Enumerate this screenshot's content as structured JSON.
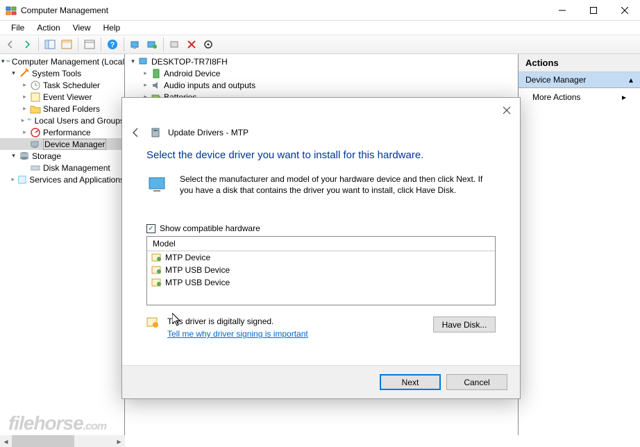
{
  "window": {
    "title": "Computer Management"
  },
  "menu": {
    "file": "File",
    "action": "Action",
    "view": "View",
    "help": "Help"
  },
  "tree": {
    "root": "Computer Management (Local",
    "systemTools": "System Tools",
    "taskScheduler": "Task Scheduler",
    "eventViewer": "Event Viewer",
    "sharedFolders": "Shared Folders",
    "localUsers": "Local Users and Groups",
    "performance": "Performance",
    "deviceManager": "Device Manager",
    "storage": "Storage",
    "diskManagement": "Disk Management",
    "servicesApps": "Services and Applications"
  },
  "center": {
    "computer": "DESKTOP-TR7I8FH",
    "android": "Android Device",
    "audio": "Audio inputs and outputs",
    "batteries": "Batteries"
  },
  "actions": {
    "header": "Actions",
    "section": "Device Manager",
    "more": "More Actions"
  },
  "dialog": {
    "title": "Update Drivers - MTP",
    "headline": "Select the device driver you want to install for this hardware.",
    "info": "Select the manufacturer and model of your hardware device and then click Next. If you have a disk that contains the driver you want to install, click Have Disk.",
    "showCompat": "Show compatible hardware",
    "modelHeader": "Model",
    "models": [
      "MTP Device",
      "MTP USB Device",
      "MTP USB Device"
    ],
    "signed": "This driver is digitally signed.",
    "signLink": "Tell me why driver signing is important",
    "haveDisk": "Have Disk...",
    "next": "Next",
    "cancel": "Cancel"
  },
  "watermark": {
    "main": "filehorse",
    "ext": ".com"
  }
}
